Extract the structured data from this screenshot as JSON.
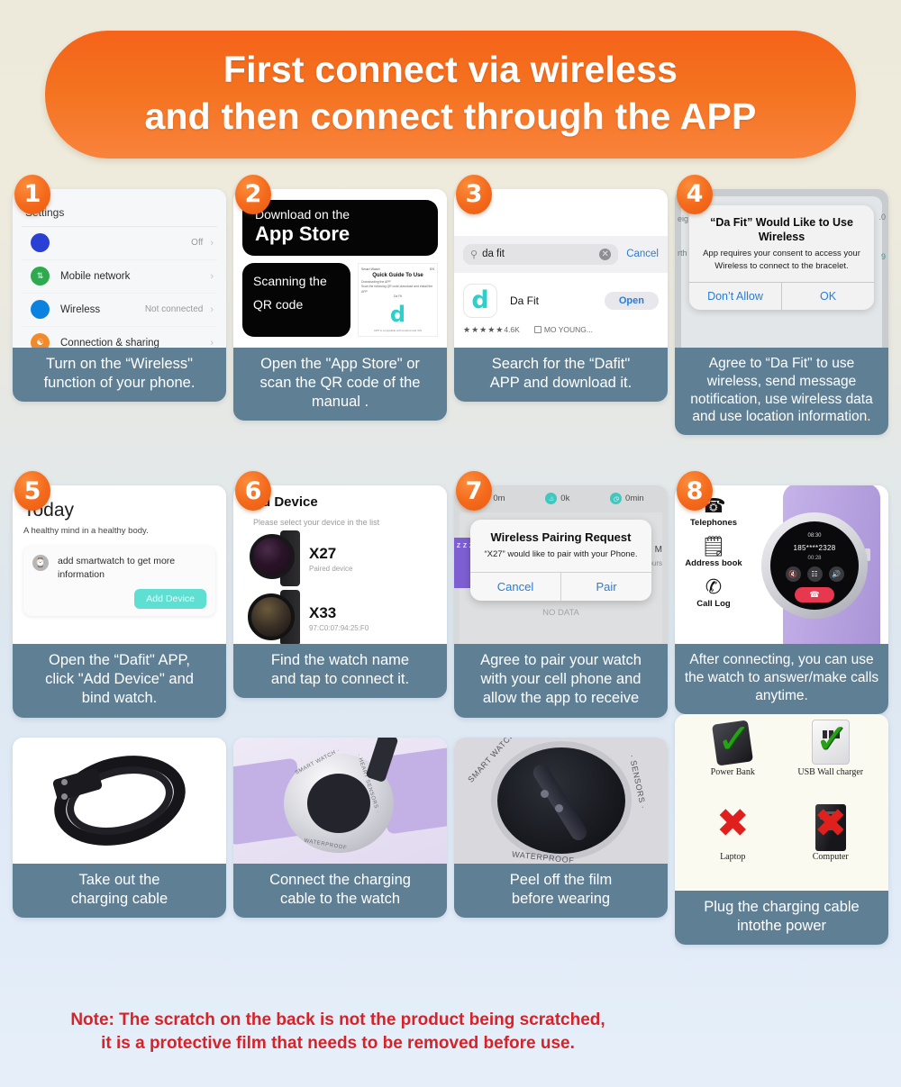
{
  "banner": {
    "line1": "First connect via wireless",
    "line2": "and then connect through the APP",
    "color": "#f4711f"
  },
  "steps": [
    {
      "number": "1",
      "caption": "Turn on the  “Wireless\"\nfunction of your phone.",
      "screen": {
        "title": "Settings",
        "rows": [
          {
            "label": "",
            "value": "Off",
            "icon": "bluetooth-icon",
            "color": "#2a3fd4"
          },
          {
            "label": "Mobile network",
            "value": "",
            "icon": "sim-icon",
            "color": "#2fa84f"
          },
          {
            "label": "Wireless",
            "value": "Not connected",
            "icon": "wifi-icon",
            "color": "#0b82e0"
          },
          {
            "label": "Connection & sharing",
            "value": "",
            "icon": "share-icon",
            "color": "#f08a2c"
          }
        ]
      }
    },
    {
      "number": "2",
      "caption": "Open the  \"App Store\" or\nscan the QR code of the\nmanual .",
      "screen": {
        "store_small": "Download on the",
        "store_large": "App Store",
        "scan_line1": "Scanning the",
        "scan_line2": "QR code",
        "manual_head_left": "Smart Watch",
        "manual_head_right": "EN",
        "manual_title": "Quick Guide To Use",
        "manual_sub": "Downloading the APP",
        "manual_body": "Scan the following QR code,download and install the APP",
        "manual_body2": "Da Fit",
        "manual_logo": "d",
        "manual_foot": "APP is compatible with Android and iOS"
      }
    },
    {
      "number": "3",
      "caption": "Search for the  “Dafit\"\nAPP and download it.",
      "screen": {
        "query": "da fit",
        "cancel": "Cancel",
        "app_name": "Da Fit",
        "app_icon_letter": "d",
        "open_button": "Open",
        "stars": "★★★★★",
        "rating": "4.6K",
        "developer": "MO YOUNG..."
      }
    },
    {
      "number": "4",
      "caption": "Agree to  “Da Fit\" to use\nwireless, send message\nnotification, use wireless data\nand use location information.",
      "screen": {
        "alert_title": "“Da Fit” Would Like to Use Wireless",
        "alert_body": "App requires your consent to access your  Wireless to connect to the bracelet.",
        "deny": "Don’t Allow",
        "allow": "OK",
        "bg_left_1": "eig",
        "bg_left_2": "rth",
        "bg_right_1": ".0",
        "bg_right_2": "9"
      }
    },
    {
      "number": "5",
      "caption": "Open the  “Dafit\" APP,\nclick \"Add Device\" and\nbind watch.",
      "screen": {
        "heading": "Today",
        "subtitle": "A healthy mind in a healthy body.",
        "card_text": "add smartwatch to get more information",
        "add_button": "Add Device"
      }
    },
    {
      "number": "6",
      "caption": "Find the watch name\nand tap to connect it.",
      "screen": {
        "heading": "Add Device",
        "subtitle": "Please select your device in the list",
        "devices": [
          {
            "name": "X27",
            "meta": "Paired device"
          },
          {
            "name": "X33",
            "meta": "97:C0:07:94:25:F0"
          }
        ]
      }
    },
    {
      "number": "7",
      "caption": "Agree to pair your watch\nwith your cell phone and\nallow the app to receive",
      "screen": {
        "stats": [
          {
            "value": "0m",
            "icon": "shield-icon"
          },
          {
            "value": "0k",
            "icon": "flame-icon"
          },
          {
            "value": "0min",
            "icon": "clock-icon"
          }
        ],
        "alert_title": "Wireless Pairing Request",
        "alert_body": "“X27” would like to pair with your  Phone.",
        "cancel": "Cancel",
        "pair": "Pair",
        "sleep_label": "z z z",
        "right_label": "M",
        "right_sub": "Hours",
        "no_data": "NO DATA"
      }
    },
    {
      "number": "8",
      "caption": "After connecting, you can use\nthe watch to answer/make calls\nanytime.",
      "screen": {
        "features": [
          {
            "label": "Telephones",
            "icon": "phone-icon"
          },
          {
            "label": "Address book",
            "icon": "contacts-icon"
          },
          {
            "label": "Call Log",
            "icon": "call-log-icon"
          }
        ],
        "watch_time": "08:30",
        "watch_number": "185****2328",
        "watch_duration": "00:28",
        "watch_buttons": [
          "mute-icon",
          "keypad-icon",
          "speaker-icon"
        ],
        "hangup": "hangup-icon"
      }
    }
  ],
  "bottom": [
    {
      "caption": "Take out the\ncharging cable",
      "image": "charging-cable-photo"
    },
    {
      "caption": "Connect the charging\ncable to the watch",
      "image": "watch-back-charging-photo",
      "ring_text": [
        "SMART WATCH ·",
        "· HEART SENSORS ·",
        "WATERPROOF"
      ]
    },
    {
      "caption": "Peel off the film\nbefore wearing",
      "image": "peel-film-photo",
      "ring_text": [
        "SMART WATCH ·",
        "· SENSORS ·",
        "WATERPROOF"
      ]
    },
    {
      "caption": "Plug the charging cable\nintothe power",
      "image": "power-source-chart",
      "items": [
        {
          "label": "Power Bank",
          "mark": "check"
        },
        {
          "label": "USB Wall charger",
          "mark": "check"
        },
        {
          "label": "Laptop",
          "mark": "cross"
        },
        {
          "label": "Computer",
          "mark": "cross"
        }
      ]
    }
  ],
  "note": "Note: The scratch on the back is not the product being scratched,\nit is a protective film that needs to be removed before use."
}
